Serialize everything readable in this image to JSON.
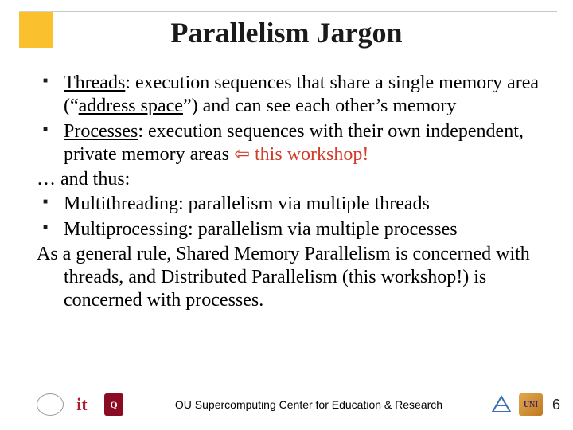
{
  "title": "Parallelism Jargon",
  "bullets": {
    "threads": {
      "term": "Threads",
      "sep": ":  ",
      "def": "execution sequences that share a single memory area (“",
      "addr": "address space",
      "def_tail": "”) and can see each other’s memory"
    },
    "processes": {
      "term": "Processes",
      "sep": ":  ",
      "def": "execution sequences with their own independent, private memory areas ",
      "arrow": "⇦",
      "tail": " this workshop!"
    },
    "and_thus": "… and thus:",
    "mt": "Multithreading:   parallelism via multiple threads",
    "mp": "Multiprocessing: parallelism via multiple processes",
    "rule": "As a general rule, Shared Memory Parallelism is concerned with threads, and Distributed Parallelism (this workshop!) is concerned with processes."
  },
  "footer": {
    "text": "OU Supercomputing Center for Education & Research",
    "page": "6",
    "logos": {
      "it": "it",
      "ou": "Q",
      "uni": "UNI"
    }
  }
}
